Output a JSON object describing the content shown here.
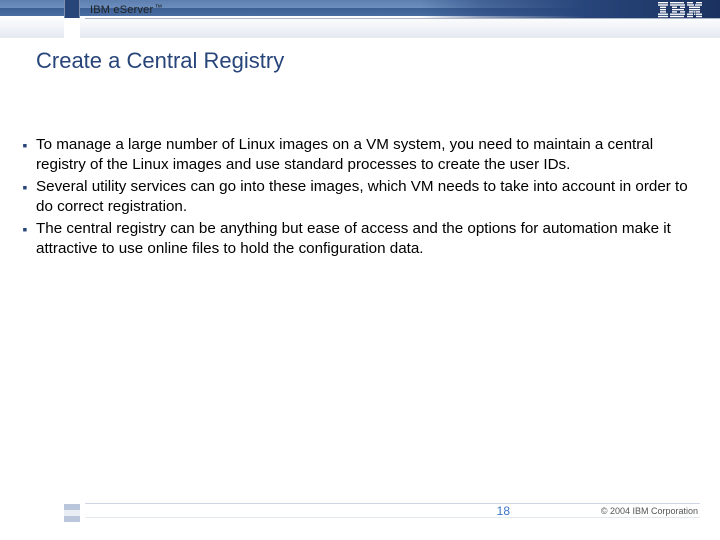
{
  "header": {
    "brand_prefix": "IBM e",
    "brand_suffix": "Server",
    "tm": "™"
  },
  "title": "Create a Central Registry",
  "bullets": [
    "To manage a large number of Linux images on a VM system, you need to maintain a central registry of the Linux images and use standard processes to create the user IDs.",
    "Several utility services can go into these images, which VM needs to take into account in order to do correct registration.",
    "The central registry can be anything but ease of access and the options for automation make it attractive to use online files to hold the configuration data."
  ],
  "footer": {
    "page_number": "18",
    "copyright": "© 2004 IBM Corporation"
  }
}
